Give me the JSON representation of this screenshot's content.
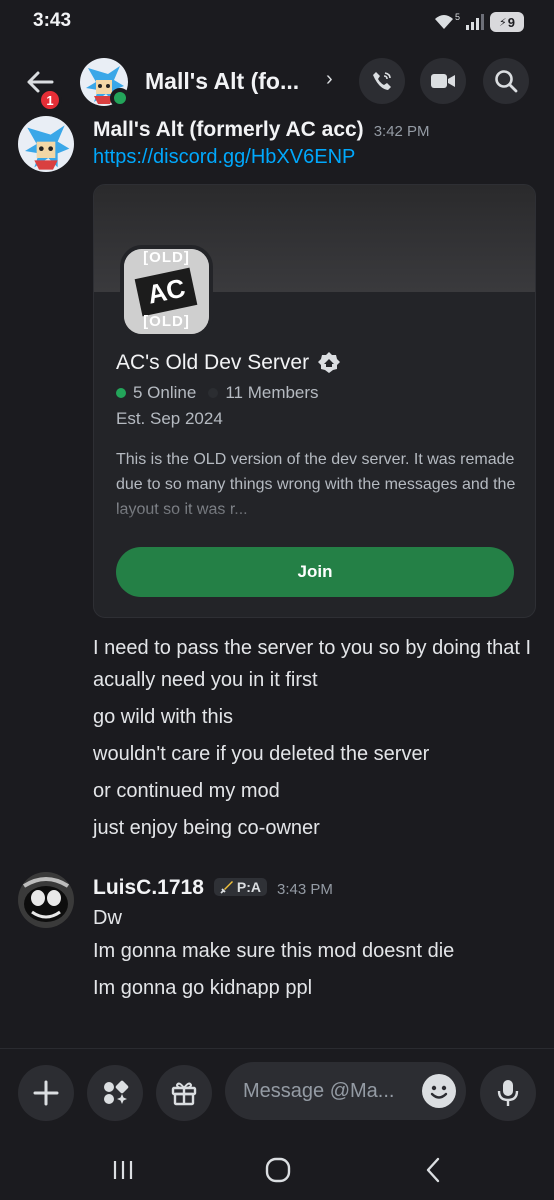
{
  "status": {
    "time": "3:43",
    "battery": "9",
    "wifi_label": "5"
  },
  "header": {
    "title": "Mall's Alt (fo...",
    "badge_count": "1",
    "chevron": "›"
  },
  "messages": [
    {
      "author": "Mall's Alt (formerly AC acc)",
      "time": "3:42 PM",
      "link": "https://discord.gg/HbXV6ENP",
      "invite": {
        "icon_top_text": "[OLD]",
        "icon_center_text": "AC",
        "icon_bottom_text": "[OLD]",
        "server_name": "AC's Old Dev Server",
        "online": "5 Online",
        "members": "11 Members",
        "est": "Est. Sep 2024",
        "description": "This is the OLD version of the dev server. It was remade due to so many things wrong with the messages and the layout so it was r...",
        "join_label": "Join"
      },
      "lines": [
        "I need to pass the server to you so by doing that I acually need you in it first",
        "go wild with this",
        "wouldn't care if you deleted the server",
        "or continued my mod",
        "just enjoy being co-owner"
      ]
    },
    {
      "author": "LuisC.1718",
      "tag": "P:A",
      "time": "3:43 PM",
      "lines": [
        "Dw",
        "Im gonna make sure this mod doesnt die",
        "Im gonna go kidnapp ppl"
      ]
    }
  ],
  "composer": {
    "placeholder": "Message @Ma..."
  },
  "colors": {
    "online": "#23a55a",
    "join": "#248046",
    "link": "#00a8fc",
    "badge": "#e62e36"
  }
}
